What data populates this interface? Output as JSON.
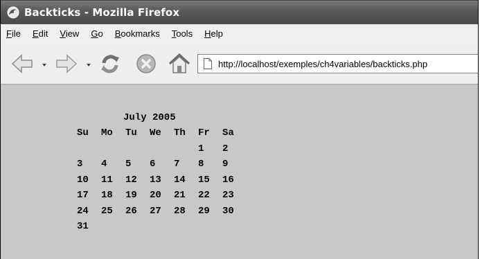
{
  "window": {
    "title": "Backticks - Mozilla Firefox"
  },
  "menu": [
    {
      "u": "F",
      "rest": "ile"
    },
    {
      "u": "E",
      "rest": "dit"
    },
    {
      "u": "V",
      "rest": "iew"
    },
    {
      "u": "G",
      "rest": "o"
    },
    {
      "u": "B",
      "rest": "ookmarks"
    },
    {
      "u": "T",
      "rest": "ools"
    },
    {
      "u": "H",
      "rest": "elp"
    }
  ],
  "toolbar": {
    "icons": [
      "back-icon",
      "forward-icon",
      "reload-icon",
      "stop-icon",
      "home-icon"
    ],
    "url": "http://localhost/exemples/ch4variables/backticks.php"
  },
  "calendar": {
    "title": "July 2005",
    "weekdays": [
      "Su",
      "Mo",
      "Tu",
      "We",
      "Th",
      "Fr",
      "Sa"
    ],
    "weeks": [
      [
        "",
        "",
        "",
        "",
        "",
        "1",
        "2"
      ],
      [
        "3",
        "4",
        "5",
        "6",
        "7",
        "8",
        "9"
      ],
      [
        "10",
        "11",
        "12",
        "13",
        "14",
        "15",
        "16"
      ],
      [
        "17",
        "18",
        "19",
        "20",
        "21",
        "22",
        "23"
      ],
      [
        "24",
        "25",
        "26",
        "27",
        "28",
        "29",
        "30"
      ],
      [
        "31",
        "",
        "",
        "",
        "",
        "",
        ""
      ]
    ]
  },
  "colors": {
    "titlebar": "#585858",
    "content_bg": "#c8c8c8",
    "toolbar_bg": "#efefed"
  }
}
